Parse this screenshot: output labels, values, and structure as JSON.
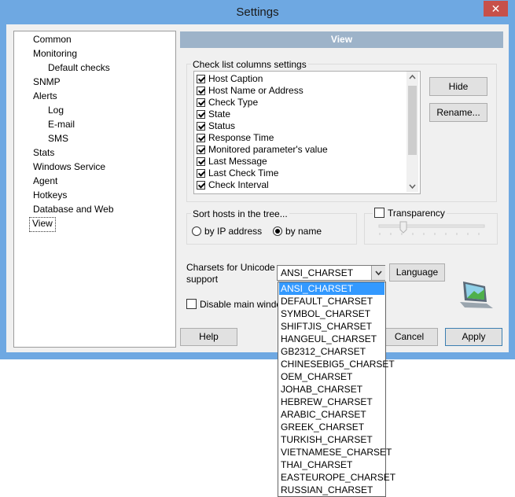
{
  "window": {
    "title": "Settings",
    "close_glyph": "✕"
  },
  "tree": {
    "items": [
      {
        "label": "Common",
        "level": 0
      },
      {
        "label": "Monitoring",
        "level": 0,
        "expanded": true
      },
      {
        "label": "Default checks",
        "level": 1
      },
      {
        "label": "SNMP",
        "level": 0
      },
      {
        "label": "Alerts",
        "level": 0,
        "expanded": true
      },
      {
        "label": "Log",
        "level": 1
      },
      {
        "label": "E-mail",
        "level": 1
      },
      {
        "label": "SMS",
        "level": 1
      },
      {
        "label": "Stats",
        "level": 0
      },
      {
        "label": "Windows Service",
        "level": 0
      },
      {
        "label": "Agent",
        "level": 0
      },
      {
        "label": "Hotkeys",
        "level": 0
      },
      {
        "label": "Database and Web",
        "level": 0
      },
      {
        "label": "View",
        "level": 0,
        "selected": true
      }
    ]
  },
  "panel": {
    "header": "View",
    "columns_group": {
      "caption": "Check list columns settings",
      "items": [
        {
          "label": "Host Caption",
          "checked": true
        },
        {
          "label": "Host Name or Address",
          "checked": true
        },
        {
          "label": "Check Type",
          "checked": true
        },
        {
          "label": "State",
          "checked": true
        },
        {
          "label": "Status",
          "checked": true
        },
        {
          "label": "Response Time",
          "checked": true
        },
        {
          "label": "Monitored parameter's value",
          "checked": true
        },
        {
          "label": "Last Message",
          "checked": true
        },
        {
          "label": "Last Check Time",
          "checked": true
        },
        {
          "label": "Check Interval",
          "checked": true
        }
      ],
      "hide_label": "Hide",
      "rename_label": "Rename..."
    },
    "sort_group": {
      "caption": "Sort hosts in the tree...",
      "by_ip_label": "by IP address",
      "by_name_label": "by name",
      "selected": "by name"
    },
    "transparency": {
      "label": "Transparency",
      "checked": false
    },
    "charsets": {
      "label_line1": "Charsets for Unicode",
      "label_line2": "support",
      "value": "ANSI_CHARSET",
      "language_label": "Language",
      "options": [
        "ANSI_CHARSET",
        "DEFAULT_CHARSET",
        "SYMBOL_CHARSET",
        "SHIFTJIS_CHARSET",
        "HANGEUL_CHARSET",
        "GB2312_CHARSET",
        "CHINESEBIG5_CHARSET",
        "OEM_CHARSET",
        "JOHAB_CHARSET",
        "HEBREW_CHARSET",
        "ARABIC_CHARSET",
        "GREEK_CHARSET",
        "TURKISH_CHARSET",
        "VIETNAMESE_CHARSET",
        "THAI_CHARSET",
        "EASTEUROPE_CHARSET",
        "RUSSIAN_CHARSET"
      ]
    },
    "disable_main": {
      "label": "Disable main windo",
      "checked": false
    }
  },
  "footer": {
    "help_label": "Help",
    "cancel_label": "Cancel",
    "apply_label": "Apply"
  },
  "colors": {
    "title_bar": "#6ea8e2",
    "header": "#9db3c9",
    "selection": "#3399ff"
  }
}
